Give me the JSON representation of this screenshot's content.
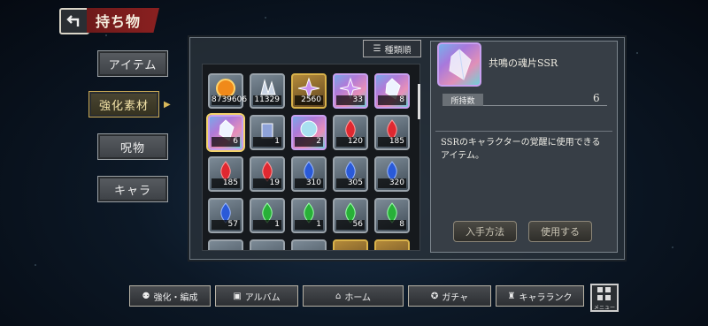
{
  "header": {
    "title": "持ち物"
  },
  "side_tabs": [
    "アイテム",
    "強化素材",
    "呪物",
    "キャラ"
  ],
  "sort_label": "種類順",
  "grid": [
    {
      "qty": "8739606",
      "kind": "gold-orb",
      "frame": "normal"
    },
    {
      "qty": "11329",
      "kind": "crystal",
      "frame": "normal"
    },
    {
      "qty": "2560",
      "kind": "star-crystal",
      "frame": "gold"
    },
    {
      "qty": "33",
      "kind": "star-crystal",
      "frame": "rainbow"
    },
    {
      "qty": "8",
      "kind": "shard",
      "frame": "rainbow"
    },
    {
      "qty": "6",
      "kind": "shard",
      "frame": "rainbow"
    },
    {
      "qty": "1",
      "kind": "tower",
      "frame": "normal"
    },
    {
      "qty": "2",
      "kind": "orb",
      "frame": "rainbow"
    },
    {
      "qty": "120",
      "kind": "red-flame",
      "frame": "normal"
    },
    {
      "qty": "185",
      "kind": "red-flame",
      "frame": "normal"
    },
    {
      "qty": "185",
      "kind": "red-flame",
      "frame": "normal"
    },
    {
      "qty": "19",
      "kind": "red-flame",
      "frame": "normal"
    },
    {
      "qty": "310",
      "kind": "blue-flame",
      "frame": "normal"
    },
    {
      "qty": "305",
      "kind": "blue-flame",
      "frame": "normal"
    },
    {
      "qty": "320",
      "kind": "blue-flame",
      "frame": "normal"
    },
    {
      "qty": "57",
      "kind": "blue-flame",
      "frame": "normal"
    },
    {
      "qty": "1",
      "kind": "green-flame",
      "frame": "normal"
    },
    {
      "qty": "1",
      "kind": "green-flame",
      "frame": "normal"
    },
    {
      "qty": "56",
      "kind": "green-flame",
      "frame": "normal"
    },
    {
      "qty": "8",
      "kind": "green-flame",
      "frame": "normal"
    },
    {
      "qty": "",
      "kind": "",
      "frame": "normal"
    },
    {
      "qty": "",
      "kind": "",
      "frame": "normal"
    },
    {
      "qty": "",
      "kind": "",
      "frame": "normal"
    },
    {
      "qty": "",
      "kind": "",
      "frame": "gold"
    },
    {
      "qty": "",
      "kind": "",
      "frame": "gold"
    }
  ],
  "selected_index": 5,
  "detail": {
    "name": "共鳴の魂片SSR",
    "owned_label": "所持数",
    "owned_value": "6",
    "description": "SSRのキャラクターの覚醒に使用できるアイテム。",
    "obtain_button": "入手方法",
    "use_button": "使用する"
  },
  "bottom_nav": [
    "強化・編成",
    "アルバム",
    "ホーム",
    "ガチャ",
    "キャラランク"
  ],
  "menu_label": "メニュー",
  "colors": {
    "accent": "#8a2020",
    "gold": "#d9b24a"
  }
}
